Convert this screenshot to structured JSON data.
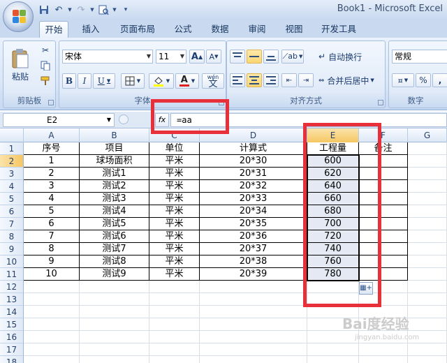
{
  "window": {
    "title": "Book1 - Microsoft Excel"
  },
  "quick_access": {
    "icons": [
      "save-icon",
      "undo-icon",
      "redo-icon",
      "print-preview-icon",
      "customize-icon"
    ]
  },
  "tabs": [
    "开始",
    "插入",
    "页面布局",
    "公式",
    "数据",
    "审阅",
    "视图",
    "开发工具"
  ],
  "active_tab": "开始",
  "ribbon": {
    "clipboard": {
      "label": "剪贴板",
      "paste_label": "粘贴"
    },
    "font": {
      "label": "字体",
      "font_name": "宋体",
      "font_size": "11",
      "bold": "B",
      "italic": "I",
      "underline": "U",
      "grow_font": "A",
      "shrink_font": "A",
      "phonetic": "wén"
    },
    "alignment": {
      "label": "对齐方式",
      "wrap_text": "自动换行",
      "merge_center": "合并后居中"
    },
    "number": {
      "label": "数字",
      "format": "常规",
      "percent": "%"
    }
  },
  "formula_bar": {
    "cell_ref": "E2",
    "fx": "fx",
    "formula": "=aa"
  },
  "sheet": {
    "columns": [
      "A",
      "B",
      "C",
      "D",
      "E",
      "F",
      "G"
    ],
    "active_column": "E",
    "active_cell": "E2",
    "row_numbers": [
      "1",
      "2",
      "3",
      "4",
      "5",
      "6",
      "7",
      "8",
      "9",
      "10",
      "11",
      "12",
      "13",
      "14",
      "15",
      "16",
      "17",
      "18"
    ],
    "header_row": [
      "序号",
      "项目",
      "单位",
      "计算式",
      "工程量",
      "备注"
    ],
    "rows": [
      [
        "1",
        "球场面积",
        "平米",
        "20*30",
        "600",
        ""
      ],
      [
        "2",
        "测试1",
        "平米",
        "20*31",
        "620",
        ""
      ],
      [
        "3",
        "测试2",
        "平米",
        "20*32",
        "640",
        ""
      ],
      [
        "4",
        "测试3",
        "平米",
        "20*33",
        "660",
        ""
      ],
      [
        "5",
        "测试4",
        "平米",
        "20*34",
        "680",
        ""
      ],
      [
        "6",
        "测试5",
        "平米",
        "20*35",
        "700",
        ""
      ],
      [
        "7",
        "测试6",
        "平米",
        "20*36",
        "720",
        ""
      ],
      [
        "8",
        "测试7",
        "平米",
        "20*37",
        "740",
        ""
      ],
      [
        "9",
        "测试8",
        "平米",
        "20*38",
        "760",
        ""
      ],
      [
        "10",
        "测试9",
        "平米",
        "20*39",
        "780",
        ""
      ]
    ]
  },
  "watermark": {
    "main": "Bai度经验",
    "sub": "jingyan.baidu.com"
  },
  "colors": {
    "annotation": "#e8303a",
    "selection": "#e4e9f3",
    "header_active": "#f6c763"
  }
}
